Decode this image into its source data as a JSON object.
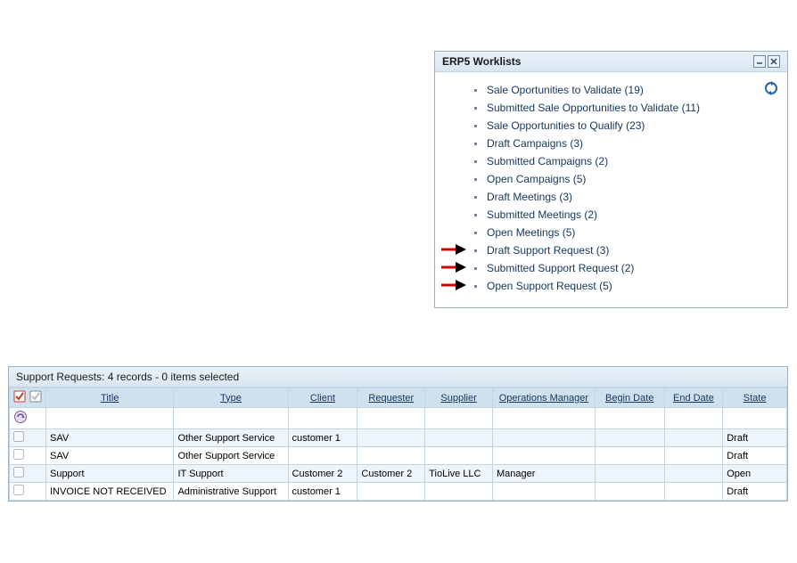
{
  "worklist": {
    "title": "ERP5 Worklists",
    "items": [
      {
        "label": "Sale Oportunities to Validate (19)",
        "highlight": false
      },
      {
        "label": "Submitted Sale Opportunities to Validate (11)",
        "highlight": false
      },
      {
        "label": "Sale Opportunities to Qualify (23)",
        "highlight": false
      },
      {
        "label": "Draft Campaigns (3)",
        "highlight": false
      },
      {
        "label": "Submitted Campaigns (2)",
        "highlight": false
      },
      {
        "label": "Open Campaigns (5)",
        "highlight": false
      },
      {
        "label": "Draft Meetings (3)",
        "highlight": false
      },
      {
        "label": "Submitted Meetings (2)",
        "highlight": false
      },
      {
        "label": "Open Meetings (5)",
        "highlight": false
      },
      {
        "label": "Draft Support Request (3)",
        "highlight": true
      },
      {
        "label": "Submitted Support Request (2)",
        "highlight": true
      },
      {
        "label": "Open Support Request (5)",
        "highlight": true
      }
    ]
  },
  "listing": {
    "header": "Support Requests: 4 records - 0 items selected",
    "columns": {
      "title": "Title",
      "type": "Type",
      "client": "Client",
      "requester": "Requester",
      "supplier": "Supplier",
      "ops": "Operations Manager",
      "begin": "Begin Date",
      "end": "End Date",
      "state": "State"
    },
    "rows": [
      {
        "title": "SAV",
        "type": "Other Support Service",
        "client": "customer 1",
        "requester": "",
        "supplier": "",
        "ops": "",
        "begin": "",
        "end": "",
        "state": "Draft"
      },
      {
        "title": "SAV",
        "type": "Other Support Service",
        "client": "",
        "requester": "",
        "supplier": "",
        "ops": "",
        "begin": "",
        "end": "",
        "state": "Draft"
      },
      {
        "title": "Support",
        "type": "IT Support",
        "client": "Customer 2",
        "requester": "Customer 2",
        "supplier": "TioLive LLC",
        "ops": "Manager",
        "begin": "",
        "end": "",
        "state": "Open"
      },
      {
        "title": "INVOICE NOT RECEIVED",
        "type": "Administrative Support",
        "client": "customer 1",
        "requester": "",
        "supplier": "",
        "ops": "",
        "begin": "",
        "end": "",
        "state": "Draft"
      }
    ]
  }
}
